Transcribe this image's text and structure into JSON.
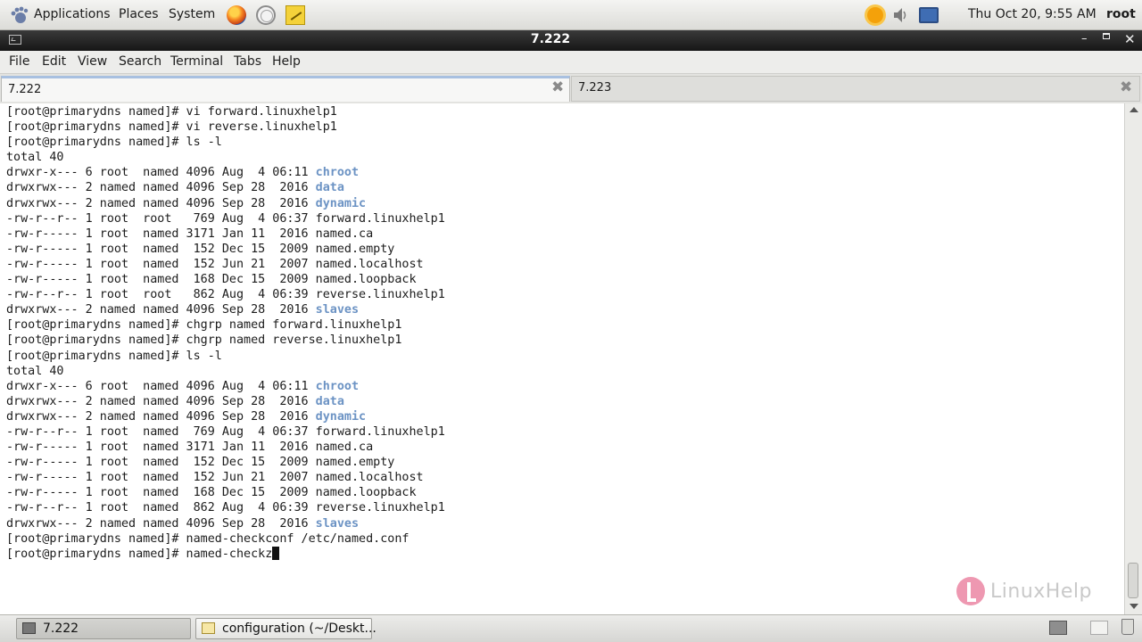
{
  "top_panel": {
    "menus": [
      "Applications",
      "Places",
      "System"
    ],
    "clock": "Thu Oct 20,  9:55 AM",
    "user": "root"
  },
  "window": {
    "title": "7.222"
  },
  "menubar": {
    "items": [
      "File",
      "Edit",
      "View",
      "Search",
      "Terminal",
      "Tabs",
      "Help"
    ]
  },
  "tabs": [
    {
      "label": "7.222",
      "active": true
    },
    {
      "label": "7.223",
      "active": false
    }
  ],
  "terminal": {
    "prompt": "[root@primarydns named]# ",
    "lines": [
      {
        "t": "prompt",
        "cmd": "vi forward.linuxhelp1"
      },
      {
        "t": "prompt",
        "cmd": "vi reverse.linuxhelp1"
      },
      {
        "t": "prompt",
        "cmd": "ls -l"
      },
      {
        "t": "text",
        "text": "total 40"
      },
      {
        "t": "entry",
        "meta": "drwxr-x--- 6 root  named 4096 Aug  4 06:11 ",
        "name": "chroot",
        "dir": true
      },
      {
        "t": "entry",
        "meta": "drwxrwx--- 2 named named 4096 Sep 28  2016 ",
        "name": "data",
        "dir": true
      },
      {
        "t": "entry",
        "meta": "drwxrwx--- 2 named named 4096 Sep 28  2016 ",
        "name": "dynamic",
        "dir": true
      },
      {
        "t": "entry",
        "meta": "-rw-r--r-- 1 root  root   769 Aug  4 06:37 ",
        "name": "forward.linuxhelp1",
        "dir": false
      },
      {
        "t": "entry",
        "meta": "-rw-r----- 1 root  named 3171 Jan 11  2016 ",
        "name": "named.ca",
        "dir": false
      },
      {
        "t": "entry",
        "meta": "-rw-r----- 1 root  named  152 Dec 15  2009 ",
        "name": "named.empty",
        "dir": false
      },
      {
        "t": "entry",
        "meta": "-rw-r----- 1 root  named  152 Jun 21  2007 ",
        "name": "named.localhost",
        "dir": false
      },
      {
        "t": "entry",
        "meta": "-rw-r----- 1 root  named  168 Dec 15  2009 ",
        "name": "named.loopback",
        "dir": false
      },
      {
        "t": "entry",
        "meta": "-rw-r--r-- 1 root  root   862 Aug  4 06:39 ",
        "name": "reverse.linuxhelp1",
        "dir": false
      },
      {
        "t": "entry",
        "meta": "drwxrwx--- 2 named named 4096 Sep 28  2016 ",
        "name": "slaves",
        "dir": true
      },
      {
        "t": "prompt",
        "cmd": "chgrp named forward.linuxhelp1"
      },
      {
        "t": "prompt",
        "cmd": "chgrp named reverse.linuxhelp1"
      },
      {
        "t": "prompt",
        "cmd": "ls -l"
      },
      {
        "t": "text",
        "text": "total 40"
      },
      {
        "t": "entry",
        "meta": "drwxr-x--- 6 root  named 4096 Aug  4 06:11 ",
        "name": "chroot",
        "dir": true
      },
      {
        "t": "entry",
        "meta": "drwxrwx--- 2 named named 4096 Sep 28  2016 ",
        "name": "data",
        "dir": true
      },
      {
        "t": "entry",
        "meta": "drwxrwx--- 2 named named 4096 Sep 28  2016 ",
        "name": "dynamic",
        "dir": true
      },
      {
        "t": "entry",
        "meta": "-rw-r--r-- 1 root  named  769 Aug  4 06:37 ",
        "name": "forward.linuxhelp1",
        "dir": false
      },
      {
        "t": "entry",
        "meta": "-rw-r----- 1 root  named 3171 Jan 11  2016 ",
        "name": "named.ca",
        "dir": false
      },
      {
        "t": "entry",
        "meta": "-rw-r----- 1 root  named  152 Dec 15  2009 ",
        "name": "named.empty",
        "dir": false
      },
      {
        "t": "entry",
        "meta": "-rw-r----- 1 root  named  152 Jun 21  2007 ",
        "name": "named.localhost",
        "dir": false
      },
      {
        "t": "entry",
        "meta": "-rw-r----- 1 root  named  168 Dec 15  2009 ",
        "name": "named.loopback",
        "dir": false
      },
      {
        "t": "entry",
        "meta": "-rw-r--r-- 1 root  named  862 Aug  4 06:39 ",
        "name": "reverse.linuxhelp1",
        "dir": false
      },
      {
        "t": "entry",
        "meta": "drwxrwx--- 2 named named 4096 Sep 28  2016 ",
        "name": "slaves",
        "dir": true
      },
      {
        "t": "prompt",
        "cmd": "named-checkconf /etc/named.conf"
      },
      {
        "t": "prompt",
        "cmd": "named-checkz",
        "cursor": true
      }
    ],
    "dir_color": "#6c93c4"
  },
  "watermark": {
    "text": "LinuxHelp"
  },
  "taskbar": {
    "tasks": [
      {
        "label": "7.222",
        "icon": "terminal-icon"
      },
      {
        "label": "configuration (~/Deskt...",
        "icon": "text-editor-icon"
      }
    ]
  },
  "icons": [
    "gnome-foot-icon",
    "firefox-icon",
    "network-icon",
    "notes-icon",
    "weather-sun-icon",
    "volume-icon",
    "display-icon"
  ]
}
